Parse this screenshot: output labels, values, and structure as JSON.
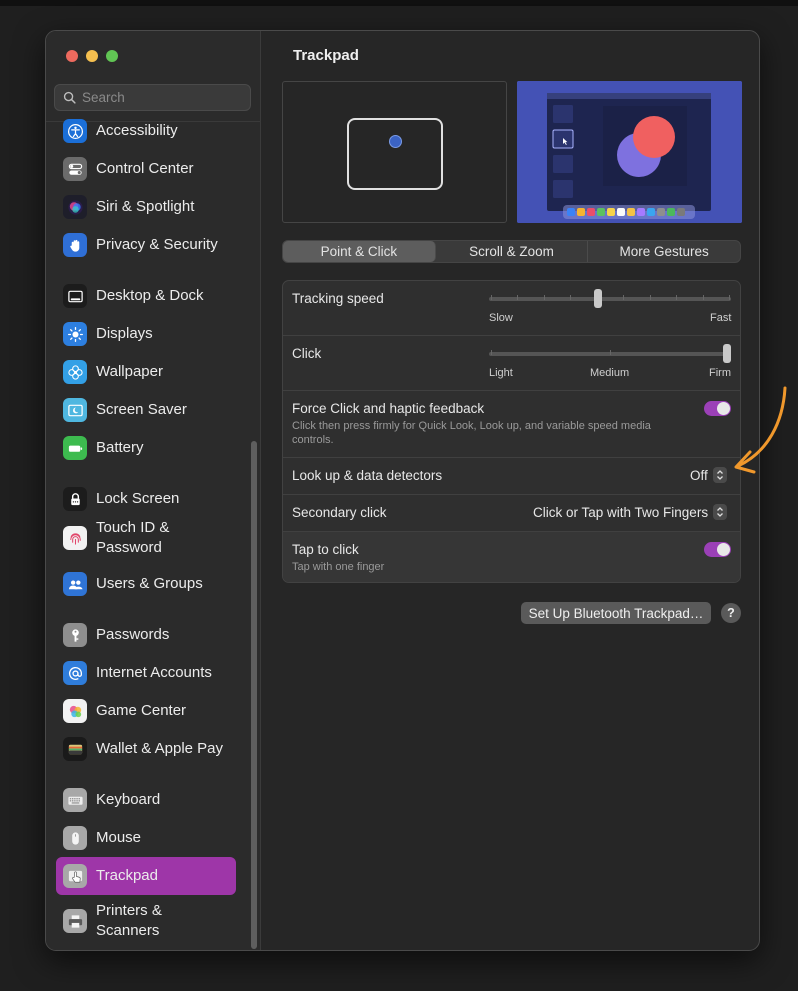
{
  "window": {
    "title": "Trackpad"
  },
  "search": {
    "placeholder": "Search"
  },
  "sidebar": {
    "items": [
      {
        "label": "Accessibility",
        "icon": "accessibility-icon",
        "color": "#1b6fd8"
      },
      {
        "label": "Control Center",
        "icon": "control-center-icon",
        "color": "#6b6b6b"
      },
      {
        "label": "Siri & Spotlight",
        "icon": "siri-icon",
        "color": "#2b2b3a"
      },
      {
        "label": "Privacy & Security",
        "icon": "hand-icon",
        "color": "#2f6fd6"
      },
      {
        "label": "Desktop & Dock",
        "icon": "dock-icon",
        "color": "#222222"
      },
      {
        "label": "Displays",
        "icon": "sun-icon",
        "color": "#2d7fe0"
      },
      {
        "label": "Wallpaper",
        "icon": "flower-icon",
        "color": "#33a0e6"
      },
      {
        "label": "Screen Saver",
        "icon": "screensaver-icon",
        "color": "#4fb7e0"
      },
      {
        "label": "Battery",
        "icon": "battery-icon",
        "color": "#3dbb4f"
      },
      {
        "label": "Lock Screen",
        "icon": "lock-icon",
        "color": "#1c1c1c"
      },
      {
        "label": "Touch ID & Password",
        "icon": "fingerprint-icon",
        "color": "#f2f2f2"
      },
      {
        "label": "Users & Groups",
        "icon": "users-icon",
        "color": "#2f74d6"
      },
      {
        "label": "Passwords",
        "icon": "key-icon",
        "color": "#8e8e8e"
      },
      {
        "label": "Internet Accounts",
        "icon": "at-icon",
        "color": "#2f7ddb"
      },
      {
        "label": "Game Center",
        "icon": "game-center-icon",
        "color": "#f2f2f2"
      },
      {
        "label": "Wallet & Apple Pay",
        "icon": "wallet-icon",
        "color": "#1a1a1a"
      },
      {
        "label": "Keyboard",
        "icon": "keyboard-icon",
        "color": "#a8a8a8"
      },
      {
        "label": "Mouse",
        "icon": "mouse-icon",
        "color": "#a8a8a8"
      },
      {
        "label": "Trackpad",
        "icon": "trackpad-icon",
        "color": "#a8a8a8",
        "selected": true
      },
      {
        "label": "Printers & Scanners",
        "icon": "printer-icon",
        "color": "#a8a8a8"
      }
    ]
  },
  "tabs": [
    {
      "label": "Point & Click",
      "selected": true
    },
    {
      "label": "Scroll & Zoom",
      "selected": false
    },
    {
      "label": "More Gestures",
      "selected": false
    }
  ],
  "settings": {
    "tracking_speed": {
      "label": "Tracking speed",
      "min_label": "Slow",
      "max_label": "Fast",
      "level": 0.45
    },
    "click": {
      "label": "Click",
      "labels": [
        "Light",
        "Medium",
        "Firm"
      ],
      "value": "Firm"
    },
    "force_click": {
      "label": "Force Click and haptic feedback",
      "description": "Click then press firmly for Quick Look, Look up, and variable speed media controls.",
      "enabled": true
    },
    "lookup": {
      "label": "Look up & data detectors",
      "value": "Off"
    },
    "secondary_click": {
      "label": "Secondary click",
      "value": "Click or Tap with Two Fingers"
    },
    "tap_to_click": {
      "label": "Tap to click",
      "description": "Tap with one finger",
      "enabled": true
    }
  },
  "footer": {
    "bluetooth_button": "Set Up Bluetooth Trackpad…",
    "help": "?"
  },
  "colors": {
    "accent": "#9e36a8",
    "toggle_on": "#9b40b7",
    "annotation_arrow": "#f0982c"
  }
}
